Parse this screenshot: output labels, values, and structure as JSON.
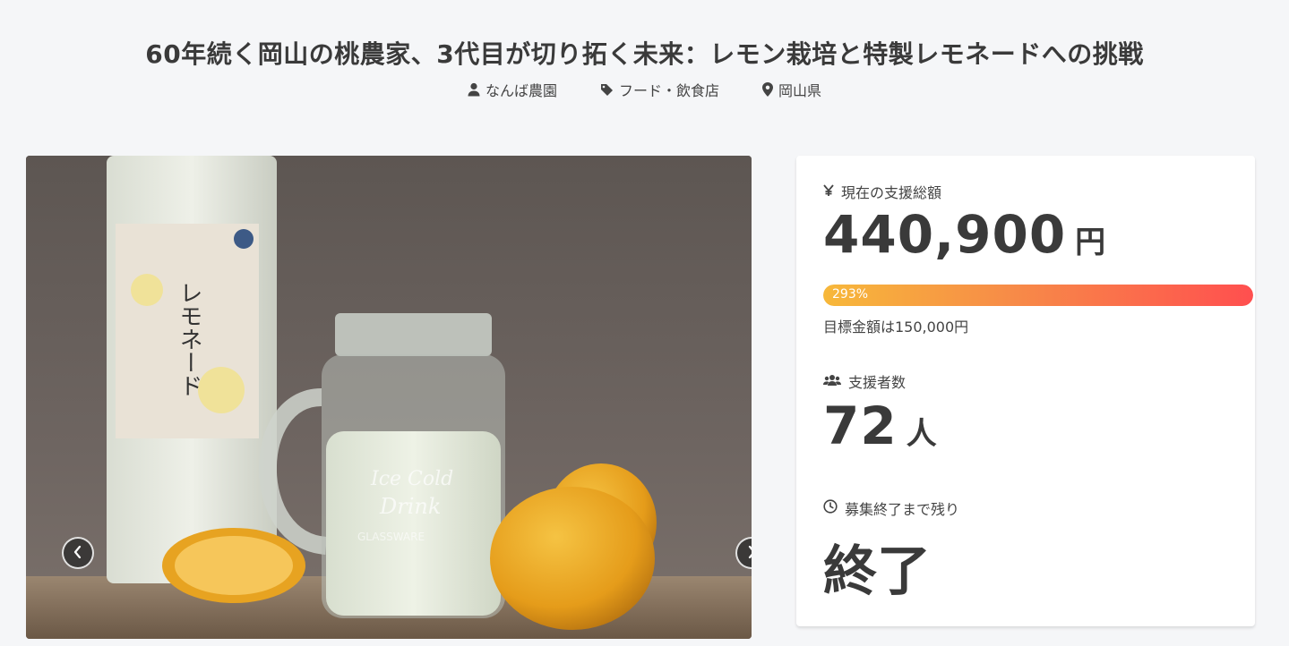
{
  "project": {
    "title": "60年続く岡山の桃農家、3代目が切り拓く未来：レモン栽培と特製レモネードへの挑戦",
    "meta": {
      "owner": "なんば農園",
      "category": "フード・飲食店",
      "location": "岡山県"
    }
  },
  "stats": {
    "total_label": "現在の支援総額",
    "total_amount": "440,900",
    "total_unit": "円",
    "progress_percent": 293,
    "progress_text": "293%",
    "goal_text": "目標金額は150,000円",
    "supporters_label": "支援者数",
    "supporters_count": "72",
    "supporters_unit": "人",
    "remaining_label": "募集終了まで残り",
    "remaining_value": "終了"
  },
  "image_text": {
    "bottle_label": "レモネード",
    "jar_text_1": "Ice Cold",
    "jar_text_2": "Drink",
    "jar_text_3": "GLASSWARE"
  },
  "colors": {
    "progress_start": "#f7b83a",
    "progress_end": "#ff4f4f"
  },
  "icons": {
    "owner": "user-icon",
    "category": "tag-icon",
    "location": "map-pin-icon",
    "total": "yen-icon",
    "supporters": "users-icon",
    "remaining": "clock-icon",
    "prev": "chevron-left-icon",
    "next": "chevron-right-icon"
  }
}
